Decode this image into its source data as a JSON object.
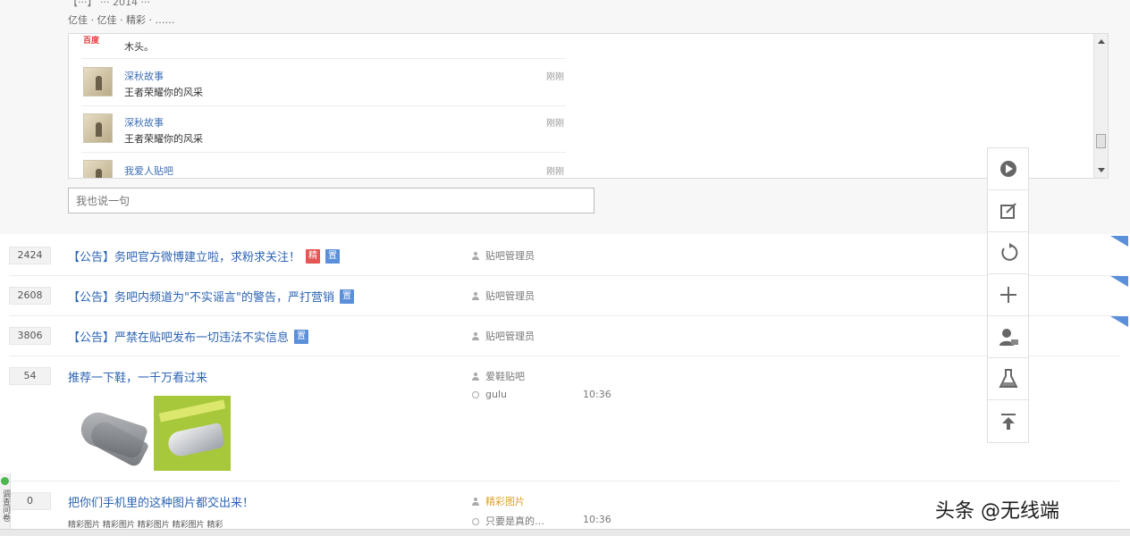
{
  "top_thread": {
    "title_cutoff": "【···】 ··· 2014 ···",
    "abstract": "亿佳 · 亿佳 · 精彩 · ……",
    "comments": [
      {
        "name": "深秋故事",
        "text": "王者荣耀你的风采",
        "time": "刚刚"
      },
      {
        "name": "深秋故事",
        "text": "王者荣耀你的风采",
        "time": "刚刚"
      },
      {
        "name": "我爱人贴吧",
        "text": "",
        "time": "刚刚"
      }
    ],
    "first_comment": {
      "logo": "百度",
      "text": "木头。"
    },
    "reply_placeholder": "我也说一句"
  },
  "threads": [
    {
      "count": "2424",
      "title": "【公告】务吧官方微博建立啦，求粉求关注！",
      "badges": [
        "精",
        "置"
      ],
      "author": "贴吧管理员",
      "corner": true
    },
    {
      "count": "2608",
      "title": "【公告】务吧内频道为\"不实谣言\"的警告，严打营销",
      "badges": [
        "置"
      ],
      "author": "贴吧管理员",
      "corner": true
    },
    {
      "count": "3806",
      "title": "【公告】严禁在贴吧发布一切违法不实信息",
      "badges": [
        "置"
      ],
      "author": "贴吧管理员",
      "corner": true
    },
    {
      "count": "54",
      "title": "推荐一下鞋，一千万看过来",
      "badges": [],
      "author": "爱鞋贴吧",
      "reply_author": "gulu",
      "reply_time": "10:36",
      "corner": false
    },
    {
      "count": "0",
      "title": "把你们手机里的这种图片都交出来！",
      "sub": "精彩图片 精彩图片 精彩图片 精彩图片 精彩",
      "badges": [],
      "author": "精彩图片",
      "reply_author": "只要是真的…",
      "reply_time": "10:36",
      "corner": false
    }
  ],
  "float_bar": {
    "items": [
      {
        "icon": "location-pin-icon"
      },
      {
        "icon": "edit-icon"
      },
      {
        "icon": "refresh-icon"
      },
      {
        "icon": "plus-icon"
      },
      {
        "icon": "user-icon"
      },
      {
        "icon": "flask-icon"
      },
      {
        "icon": "back-to-top-icon"
      }
    ]
  },
  "left_tab": {
    "text": "调查问卷"
  },
  "watermark": "头条 @无线端",
  "colors": {
    "link": "#2d64b3",
    "badge_blue": "#5b8fd9",
    "badge_red": "#e65454",
    "accent_yellow": "#e0a32a"
  }
}
